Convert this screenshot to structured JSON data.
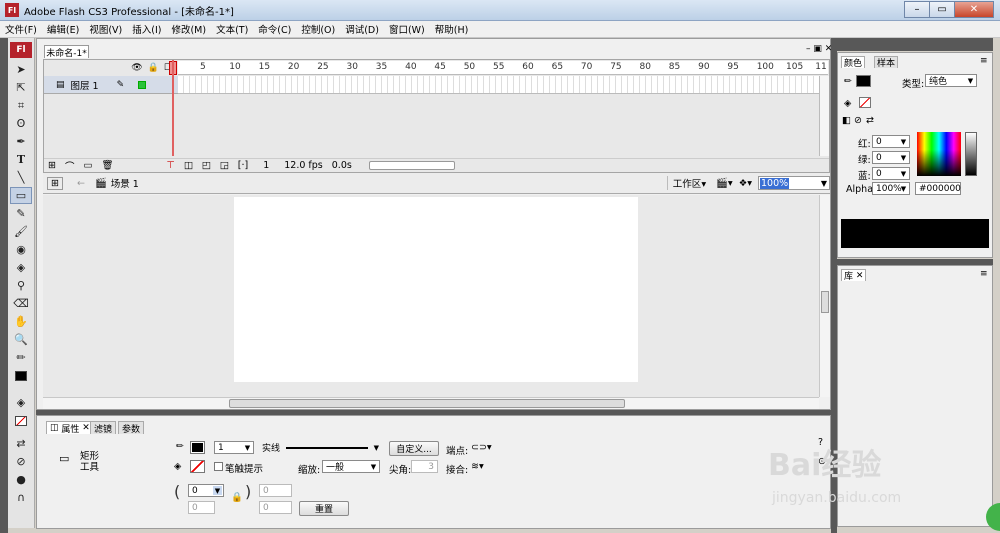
{
  "window": {
    "title": "Adobe Flash CS3 Professional - [未命名-1*]",
    "app_badge": "Fl"
  },
  "menu": [
    "文件(F)",
    "编辑(E)",
    "视图(V)",
    "插入(I)",
    "修改(M)",
    "文本(T)",
    "命令(C)",
    "控制(O)",
    "调试(D)",
    "窗口(W)",
    "帮助(H)"
  ],
  "tools_badge": "Fl",
  "document": {
    "tab": "未命名-1*"
  },
  "timeline": {
    "ruler": [
      "5",
      "10",
      "15",
      "20",
      "25",
      "30",
      "35",
      "40",
      "45",
      "50",
      "55",
      "60",
      "65",
      "70",
      "75",
      "80",
      "85",
      "90",
      "95",
      "100",
      "105",
      "11"
    ],
    "layer": "图层 1",
    "frame": "1",
    "fps": "12.0 fps",
    "time": "0.0s"
  },
  "editbar": {
    "scene": "场景 1",
    "workspace": "工作区",
    "zoom": "100%"
  },
  "properties": {
    "tabs": [
      "属性",
      "滤镜",
      "参数"
    ],
    "tool_line1": "矩形",
    "tool_line2": "工具",
    "stroke_width": "1",
    "stroke_style": "实线",
    "custom": "自定义...",
    "endpoint": "端点:",
    "hint": "笔触提示",
    "scale": "缩放:",
    "scale_value": "一般",
    "miter": "尖角:",
    "miter_value": "3",
    "join": "接合:",
    "corner_values": [
      "0",
      "0",
      "0",
      "0"
    ],
    "reset": "重置"
  },
  "color_panel": {
    "tabs": [
      "颜色",
      "样本"
    ],
    "type_label": "类型:",
    "type_value": "纯色",
    "red_label": "红:",
    "green_label": "绿:",
    "blue_label": "蓝:",
    "red": "0",
    "green": "0",
    "blue": "0",
    "alpha_label": "Alpha:",
    "alpha": "100%",
    "hex": "#000000"
  },
  "library_panel": {
    "tab": "库"
  },
  "watermark": {
    "brand": "Bai经验",
    "url": "jingyan.baidu.com"
  },
  "colors": {
    "accent": "#b5222b",
    "chrome": "#585858",
    "stage": "#ffffff"
  }
}
